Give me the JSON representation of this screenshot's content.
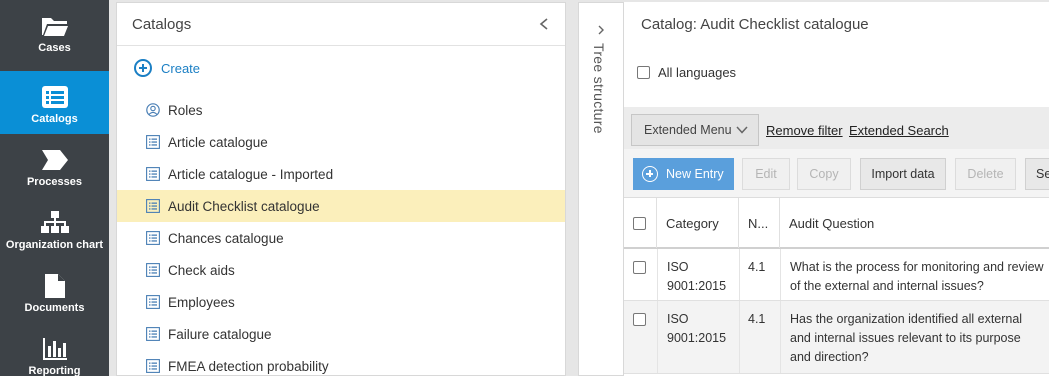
{
  "nav": {
    "items": [
      {
        "label": "Cases",
        "icon": "folder-icon",
        "active": false
      },
      {
        "label": "Catalogs",
        "icon": "list-icon",
        "active": true
      },
      {
        "label": "Processes",
        "icon": "process-arrow-icon",
        "active": false
      },
      {
        "label": "Organization chart",
        "icon": "org-chart-icon",
        "active": false
      },
      {
        "label": "Documents",
        "icon": "document-icon",
        "active": false
      },
      {
        "label": "Reporting",
        "icon": "bar-chart-icon",
        "active": false
      }
    ],
    "active_color": "#0a8fd6",
    "bg_color": "#3d4247"
  },
  "catalogs": {
    "title": "Catalogs",
    "create_label": "Create",
    "items": [
      {
        "label": "Roles",
        "icon": "user-circle-icon"
      },
      {
        "label": "Article catalogue",
        "icon": "catalog-list-icon"
      },
      {
        "label": "Article catalogue - Imported",
        "icon": "catalog-list-icon"
      },
      {
        "label": "Audit Checklist catalogue",
        "icon": "catalog-list-icon",
        "selected": true
      },
      {
        "label": "Chances catalogue",
        "icon": "catalog-list-icon"
      },
      {
        "label": "Check aids",
        "icon": "catalog-list-icon"
      },
      {
        "label": "Employees",
        "icon": "catalog-list-icon"
      },
      {
        "label": "Failure catalogue",
        "icon": "catalog-list-icon"
      },
      {
        "label": "FMEA detection probability",
        "icon": "catalog-list-icon"
      }
    ]
  },
  "tree": {
    "label": "Tree structure"
  },
  "main": {
    "title": "Catalog: Audit Checklist catalogue",
    "all_languages_label": "All languages",
    "extended_menu_label": "Extended Menu",
    "remove_filter_label": "Remove filter",
    "extended_search_label": "Extended Search",
    "buttons": {
      "new_entry": "New Entry",
      "edit": "Edit",
      "copy": "Copy",
      "import_data": "Import data",
      "delete": "Delete",
      "more": "Se"
    },
    "table": {
      "headers": [
        "Category",
        "N...",
        "Audit Question"
      ],
      "rows": [
        {
          "category": "ISO 9001:2015",
          "number": "4.1",
          "question": "What is the process for monitoring and review of the external and internal issues?"
        },
        {
          "category": "ISO 9001:2015",
          "number": "4.1",
          "question": "Has the organization identified all external and internal issues relevant to its purpose and direction?"
        }
      ]
    }
  }
}
